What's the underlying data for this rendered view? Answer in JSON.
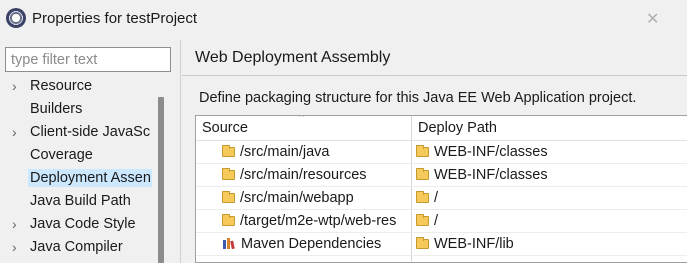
{
  "window": {
    "title": "Properties for testProject",
    "close_glyph": "✕"
  },
  "filter": {
    "placeholder": "type filter text",
    "value": ""
  },
  "nav": {
    "items": [
      {
        "label": "Resource",
        "arrow": "›",
        "selected": false
      },
      {
        "label": "Builders",
        "arrow": "",
        "selected": false
      },
      {
        "label": "Client-side JavaSc",
        "arrow": "›",
        "selected": false
      },
      {
        "label": "Coverage",
        "arrow": "",
        "selected": false
      },
      {
        "label": "Deployment Assen",
        "arrow": "",
        "selected": true
      },
      {
        "label": "Java Build Path",
        "arrow": "",
        "selected": false
      },
      {
        "label": "Java Code Style",
        "arrow": "›",
        "selected": false
      },
      {
        "label": "Java Compiler",
        "arrow": "›",
        "selected": false
      }
    ]
  },
  "page": {
    "title": "Web Deployment Assembly",
    "description": "Define packaging structure for this Java EE Web Application project."
  },
  "table": {
    "headers": {
      "source": "Source",
      "deploy_path": "Deploy Path",
      "sort_glyph": "^"
    },
    "rows": [
      {
        "source": "/src/main/java",
        "deploy_path": "WEB-INF/classes",
        "icon": "folder-icon"
      },
      {
        "source": "/src/main/resources",
        "deploy_path": "WEB-INF/classes",
        "icon": "folder-icon"
      },
      {
        "source": "/src/main/webapp",
        "deploy_path": "/",
        "icon": "folder-icon"
      },
      {
        "source": "/target/m2e-wtp/web-res",
        "deploy_path": "/",
        "icon": "folder-icon"
      },
      {
        "source": "Maven Dependencies",
        "deploy_path": "WEB-INF/lib",
        "icon": "maven-library-icon"
      }
    ]
  },
  "colors": {
    "selection": "#cce8ff",
    "folder": "#f5c95a",
    "scrollbar": "#8c8c8c"
  }
}
